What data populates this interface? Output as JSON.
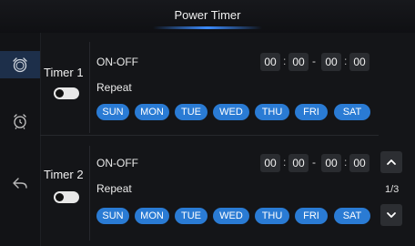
{
  "window": {
    "title": "Power Timer"
  },
  "sidebar": {
    "items": [
      {
        "name": "timer",
        "icon": "alarm-clock-icon",
        "active": true
      },
      {
        "name": "alarm",
        "icon": "alarm-icon",
        "active": false
      },
      {
        "name": "back",
        "icon": "back-arrow-icon",
        "active": false
      }
    ]
  },
  "timers": [
    {
      "label": "Timer 1",
      "enabled": false,
      "onoff_label": "ON-OFF",
      "on_hh": "00",
      "on_mm": "00",
      "off_hh": "00",
      "off_mm": "00",
      "repeat_label": "Repeat"
    },
    {
      "label": "Timer 2",
      "enabled": false,
      "onoff_label": "ON-OFF",
      "on_hh": "00",
      "on_mm": "00",
      "off_hh": "00",
      "off_mm": "00",
      "repeat_label": "Repeat"
    }
  ],
  "days": [
    "SUN",
    "MON",
    "TUE",
    "WED",
    "THU",
    "FRI",
    "SAT"
  ],
  "pagination": {
    "indicator": "1/3"
  },
  "colors": {
    "accent": "#2a7bd4",
    "background": "#141518",
    "active_nav": "#1d2f4a"
  }
}
